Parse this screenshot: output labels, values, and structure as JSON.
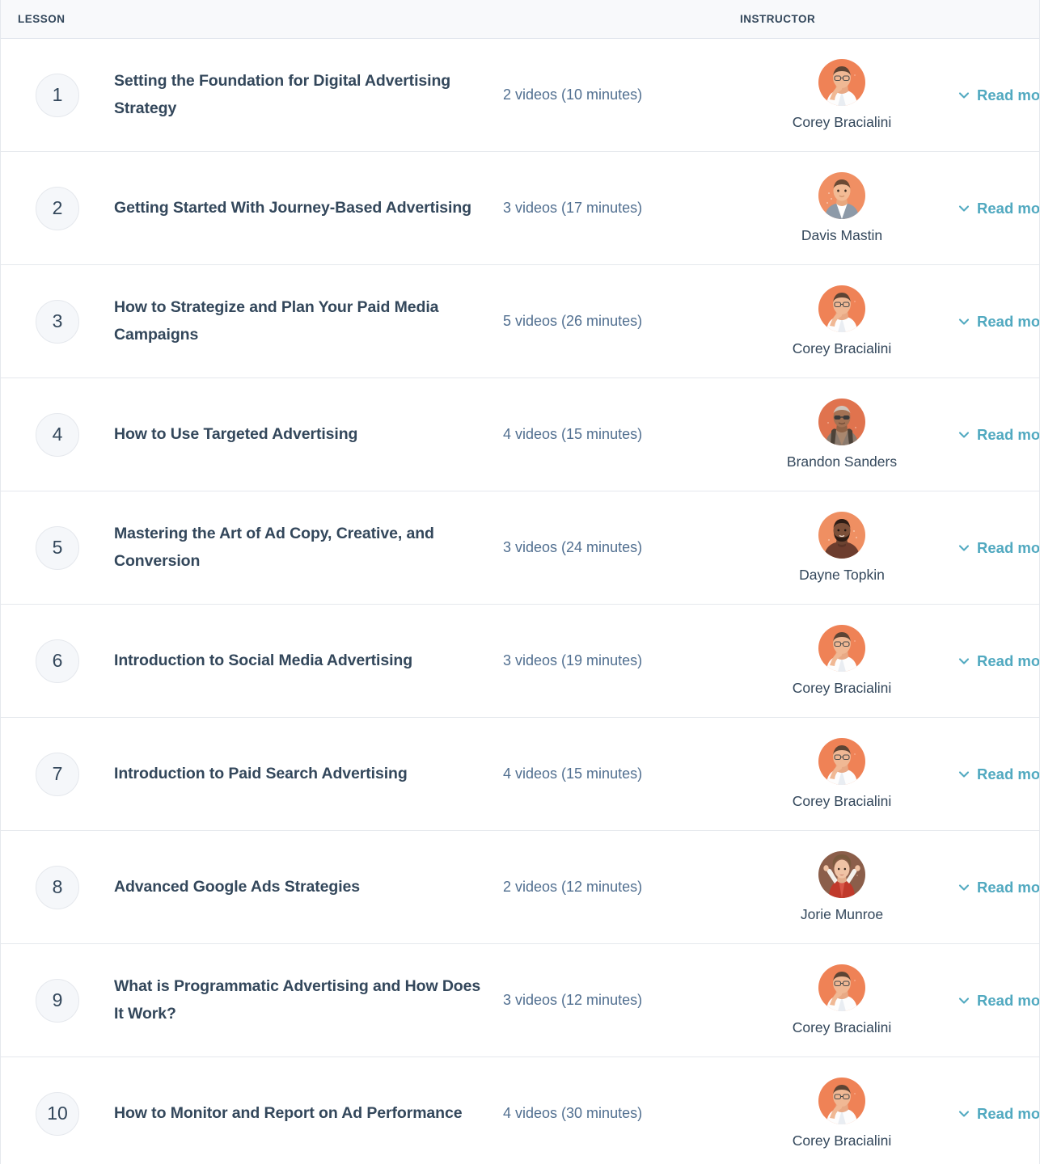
{
  "header": {
    "lesson_label": "LESSON",
    "instructor_label": "INSTRUCTOR"
  },
  "colors": {
    "accent_link": "#51a9c0",
    "text_primary": "#33475b",
    "text_muted": "#516f90",
    "header_bg": "#f8f9fb",
    "border": "#e5e8ed",
    "circle_bg": "#f5f7fa",
    "avatar_orange": "#e8795a",
    "avatar_brown": "#8a5a4a"
  },
  "action": {
    "read_more_label": "Read more",
    "chevron_icon": "chevron-down-icon"
  },
  "instructors": {
    "corey": {
      "name": "Corey Bracialini",
      "avatar": "corey-avatar"
    },
    "davis": {
      "name": "Davis Mastin",
      "avatar": "davis-avatar"
    },
    "brandon": {
      "name": "Brandon Sanders",
      "avatar": "brandon-avatar"
    },
    "dayne": {
      "name": "Dayne Topkin",
      "avatar": "dayne-avatar"
    },
    "jorie": {
      "name": "Jorie Munroe",
      "avatar": "jorie-avatar"
    }
  },
  "lessons": [
    {
      "number": "1",
      "title": "Setting the Foundation for Digital Advertising Strategy",
      "videos": "2 videos (10 minutes)",
      "instructor": "Corey Bracialini",
      "avatar": "corey",
      "read_more": "Read more"
    },
    {
      "number": "2",
      "title": "Getting Started With Journey-Based Advertising",
      "videos": "3 videos (17 minutes)",
      "instructor": "Davis Mastin",
      "avatar": "davis",
      "read_more": "Read more"
    },
    {
      "number": "3",
      "title": "How to Strategize and Plan Your Paid Media Campaigns",
      "videos": "5 videos (26 minutes)",
      "instructor": "Corey Bracialini",
      "avatar": "corey",
      "read_more": "Read more"
    },
    {
      "number": "4",
      "title": "How to Use Targeted Advertising",
      "videos": "4 videos (15 minutes)",
      "instructor": "Brandon Sanders",
      "avatar": "brandon",
      "read_more": "Read more"
    },
    {
      "number": "5",
      "title": "Mastering the Art of Ad Copy, Creative, and Conversion",
      "videos": "3 videos (24 minutes)",
      "instructor": "Dayne Topkin",
      "avatar": "dayne",
      "read_more": "Read more"
    },
    {
      "number": "6",
      "title": "Introduction to Social Media Advertising",
      "videos": "3 videos (19 minutes)",
      "instructor": "Corey Bracialini",
      "avatar": "corey",
      "read_more": "Read more"
    },
    {
      "number": "7",
      "title": "Introduction to Paid Search Advertising",
      "videos": "4 videos (15 minutes)",
      "instructor": "Corey Bracialini",
      "avatar": "corey",
      "read_more": "Read more"
    },
    {
      "number": "8",
      "title": "Advanced Google Ads Strategies",
      "videos": "2 videos (12 minutes)",
      "instructor": "Jorie Munroe",
      "avatar": "jorie",
      "read_more": "Read more"
    },
    {
      "number": "9",
      "title": "What is Programmatic Advertising and How Does It Work?",
      "videos": "3 videos (12 minutes)",
      "instructor": "Corey Bracialini",
      "avatar": "corey",
      "read_more": "Read more"
    },
    {
      "number": "10",
      "title": "How to Monitor and Report on Ad Performance",
      "videos": "4 videos (30 minutes)",
      "instructor": "Corey Bracialini",
      "avatar": "corey",
      "read_more": "Read more"
    }
  ]
}
